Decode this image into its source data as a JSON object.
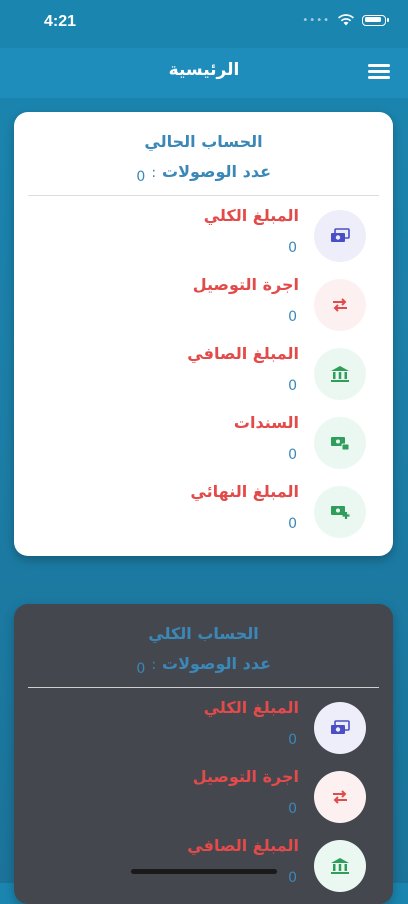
{
  "status": {
    "time": "4:21"
  },
  "navbar": {
    "title": "الرئيسية",
    "menu_icon": "hamburger-menu-icon"
  },
  "cards": [
    {
      "title": "الحساب الحالي",
      "count_label": "عدد الوصولات",
      "count_colon": ":",
      "count_value": "0",
      "rows": [
        {
          "label": "المبلغ الكلي",
          "value": "0",
          "icon": "money-icon"
        },
        {
          "label": "اجرة التوصيل",
          "value": "0",
          "icon": "transfer-arrows-icon"
        },
        {
          "label": "المبلغ الصافي",
          "value": "0",
          "icon": "bank-icon"
        },
        {
          "label": "السندات",
          "value": "0",
          "icon": "money-lock-icon"
        },
        {
          "label": "المبلغ النهائي",
          "value": "0",
          "icon": "money-add-icon"
        }
      ]
    },
    {
      "title": "الحساب الكلي",
      "count_label": "عدد الوصولات",
      "count_colon": ":",
      "count_value": "0",
      "rows": [
        {
          "label": "المبلغ الكلي",
          "value": "0",
          "icon": "money-icon"
        },
        {
          "label": "اجرة التوصيل",
          "value": "0",
          "icon": "transfer-arrows-icon"
        },
        {
          "label": "المبلغ الصافي",
          "value": "0",
          "icon": "bank-icon"
        }
      ]
    }
  ],
  "colors": {
    "header": "#1f8dbb",
    "label_red": "#e34a4a",
    "value_blue": "#3a88b8",
    "dark_card": "#45474f"
  }
}
